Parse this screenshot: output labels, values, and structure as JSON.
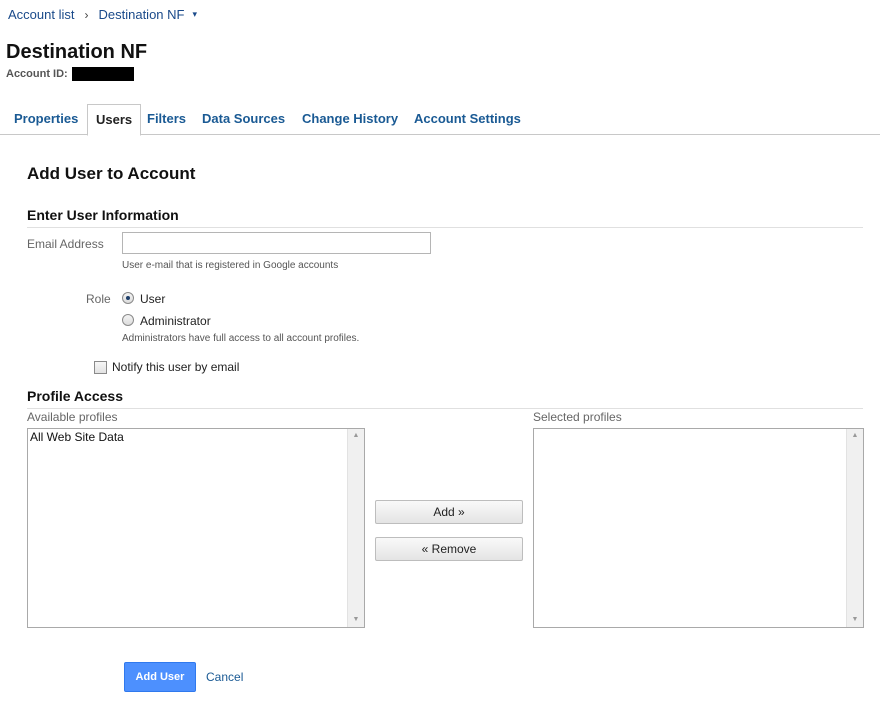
{
  "breadcrumb": {
    "account_list": "Account list",
    "separator": "›",
    "current": "Destination NF",
    "caret": "▾"
  },
  "header": {
    "title": "Destination NF",
    "account_id_label": "Account ID:"
  },
  "tabs": [
    {
      "label": "Properties",
      "active": false
    },
    {
      "label": "Users",
      "active": true
    },
    {
      "label": "Filters",
      "active": false
    },
    {
      "label": "Data Sources",
      "active": false
    },
    {
      "label": "Change History",
      "active": false
    },
    {
      "label": "Account Settings",
      "active": false
    }
  ],
  "form": {
    "heading": "Add User to Account",
    "user_info_title": "Enter User Information",
    "email_label": "Email Address",
    "email_value": "",
    "email_hint": "User e-mail that is registered in Google accounts",
    "role_label": "Role",
    "role_options": [
      {
        "label": "User",
        "selected": true
      },
      {
        "label": "Administrator",
        "selected": false
      }
    ],
    "admin_hint": "Administrators have full access to all account profiles.",
    "notify_label": "Notify this user by email",
    "notify_checked": false,
    "profile_access_title": "Profile Access",
    "available_label": "Available profiles",
    "selected_label": "Selected profiles",
    "available_profiles": [
      "All Web Site Data"
    ],
    "selected_profiles": [],
    "add_button": "Add »",
    "remove_button": "« Remove",
    "submit_button": "Add User",
    "cancel_link": "Cancel"
  },
  "colors": {
    "link": "#1a5a94",
    "primary_button": "#4d90fe"
  }
}
